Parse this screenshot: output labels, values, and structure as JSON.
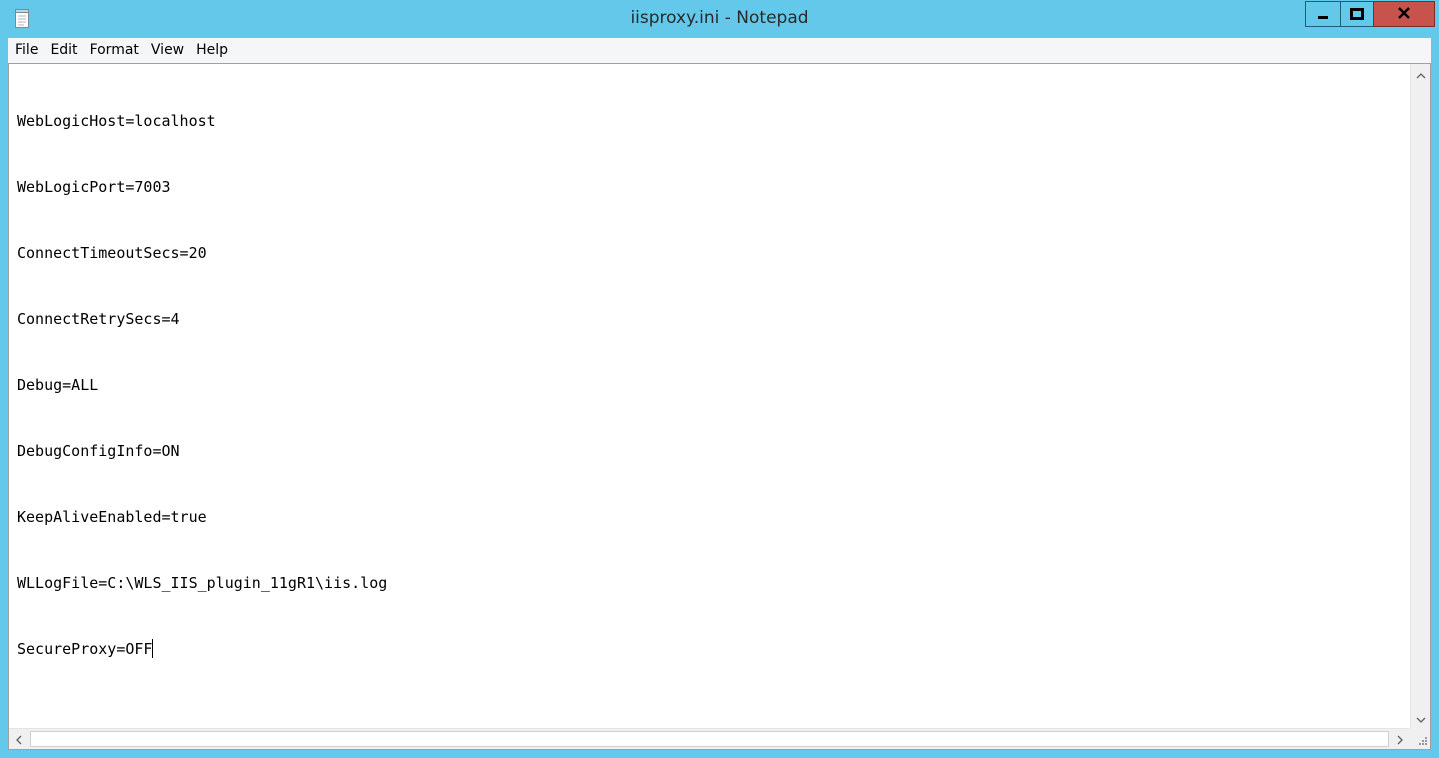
{
  "window": {
    "title": "iisproxy.ini - Notepad"
  },
  "menu": {
    "items": [
      {
        "label": "File"
      },
      {
        "label": "Edit"
      },
      {
        "label": "Format"
      },
      {
        "label": "View"
      },
      {
        "label": "Help"
      }
    ]
  },
  "editor": {
    "lines": [
      "WebLogicHost=localhost",
      "WebLogicPort=7003",
      "ConnectTimeoutSecs=20",
      "ConnectRetrySecs=4",
      "Debug=ALL",
      "DebugConfigInfo=ON",
      "KeepAliveEnabled=true",
      "WLLogFile=C:\\WLS_IIS_plugin_11gR1\\iis.log",
      "SecureProxy=OFF"
    ]
  },
  "icons": {
    "app": "notepad-icon",
    "minimize": "minimize-icon",
    "maximize": "maximize-icon",
    "close": "close-icon"
  },
  "colors": {
    "titlebar": "#63c8ea",
    "close_button": "#c7534c",
    "menubar": "#f5f6f7"
  }
}
